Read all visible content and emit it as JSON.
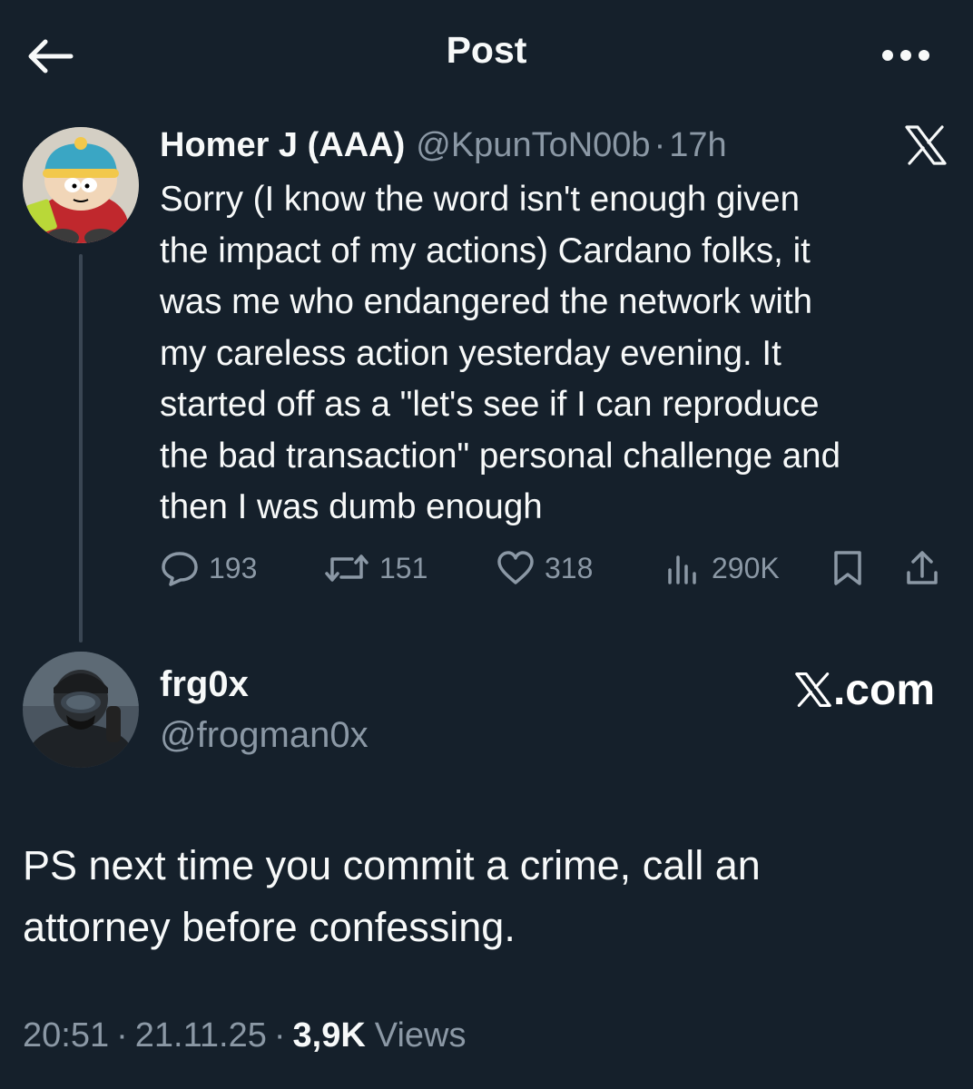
{
  "header": {
    "title": "Post"
  },
  "quoted_post": {
    "author_name": "Homer J (AAA)",
    "author_handle": "@KpunToN00b",
    "separator": "·",
    "time": "17h",
    "body_lines": [
      "Sorry (I know the word isn't enough given",
      "the impact of my actions) Cardano folks, it",
      "was me who endangered the network with",
      "my careless action yesterday evening. It",
      "started off as a \"let's see if I can reproduce",
      "the bad transaction\" personal challenge and",
      "then I was dumb enough"
    ],
    "stats": {
      "replies": "193",
      "reposts": "151",
      "likes": "318",
      "views": "290K"
    }
  },
  "post": {
    "author_name": "frg0x",
    "author_handle": "@frogman0x",
    "watermark": ".com",
    "body_lines": [
      "PS next time you commit a crime, call an",
      "attorney before confessing."
    ],
    "time": "20:51",
    "date": "21.11.25",
    "separator": "·",
    "views_count": "3,9K",
    "views_label": "Views"
  },
  "icons": {
    "back": "arrow-left-icon",
    "more": "more-horizontal-icon",
    "x_logo": "x-logo-icon",
    "reply": "reply-icon",
    "repost": "repost-icon",
    "like": "heart-icon",
    "views": "views-chart-icon",
    "bookmark": "bookmark-icon",
    "share": "share-icon"
  },
  "colors": {
    "background": "#15202b",
    "text_primary": "#f7f9f9",
    "text_secondary": "#8b98a5",
    "thread_line": "#3a4653"
  }
}
